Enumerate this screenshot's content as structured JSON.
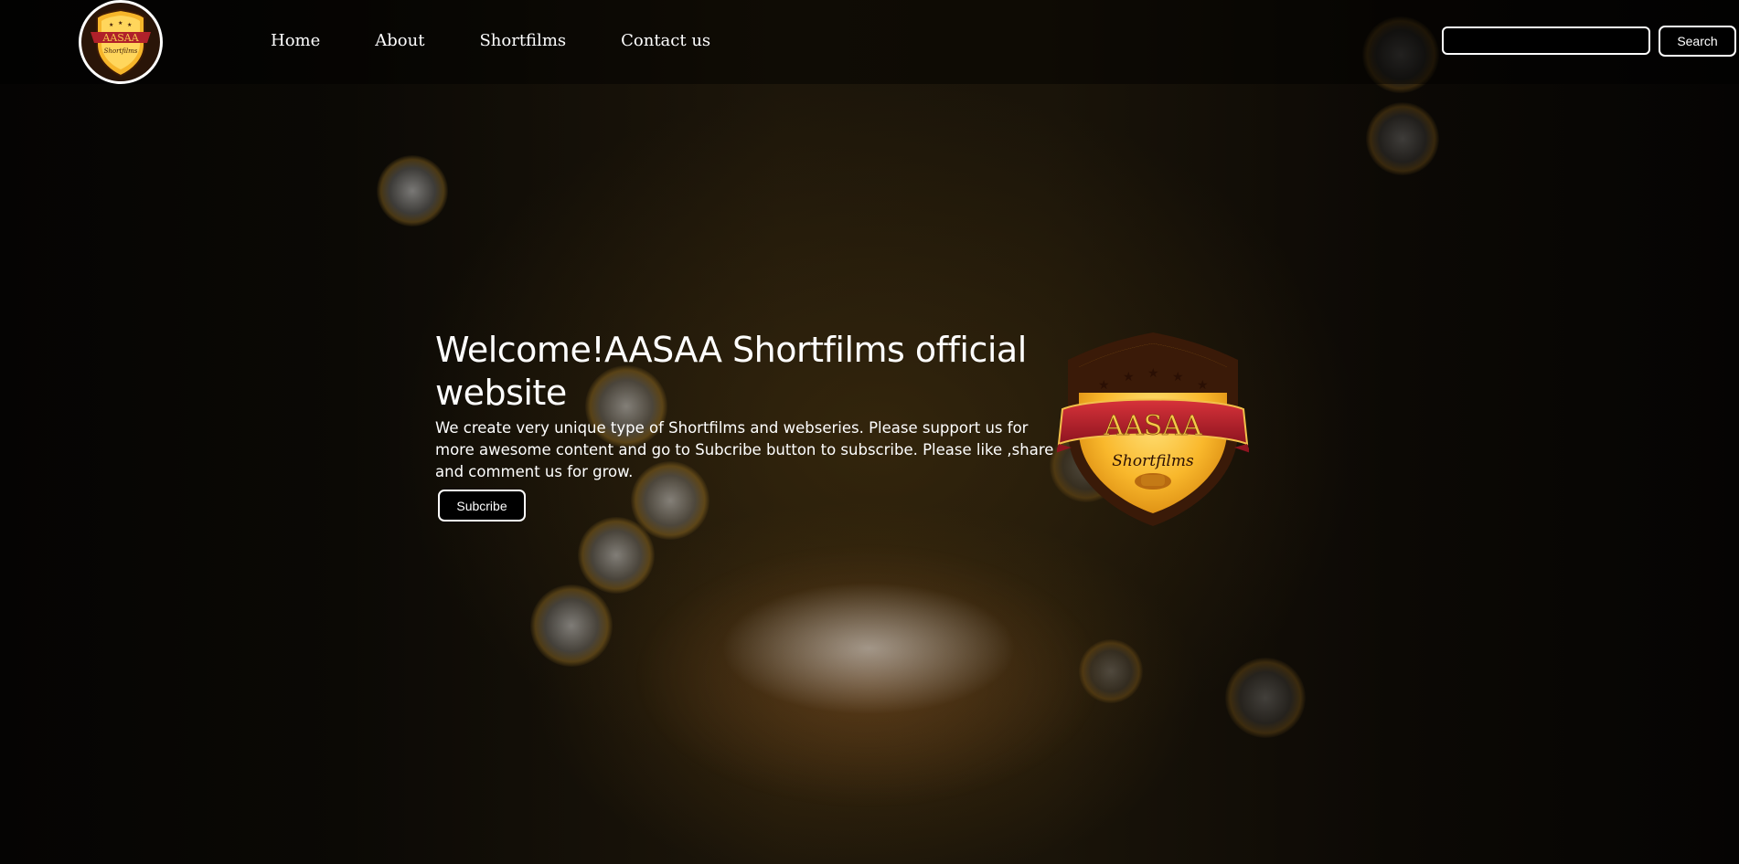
{
  "brand": {
    "logo_text": "AASAA",
    "logo_subtext": "Shortfilms"
  },
  "nav": {
    "items": [
      {
        "label": "Home"
      },
      {
        "label": "About"
      },
      {
        "label": "Shortfilms"
      },
      {
        "label": "Contact us"
      }
    ]
  },
  "search": {
    "value": "",
    "placeholder": "",
    "button_label": "Search"
  },
  "hero": {
    "title": "Welcome!AASAA Shortfilms official website",
    "text": "We create very unique type of Shortfilms and webseries. Please support us for more awesome content and go to Subcribe button to subscribe. Please like ,share and comment us for grow.",
    "button_label": "Subcribe"
  },
  "colors": {
    "background": "#000000",
    "text": "#ffffff",
    "accent_gold": "#f6b52a",
    "accent_red": "#b0202a",
    "shield_dark": "#2a1508"
  },
  "icons": {
    "logo_small": "aasaa-shield-logo",
    "logo_large": "aasaa-shield-logo"
  }
}
